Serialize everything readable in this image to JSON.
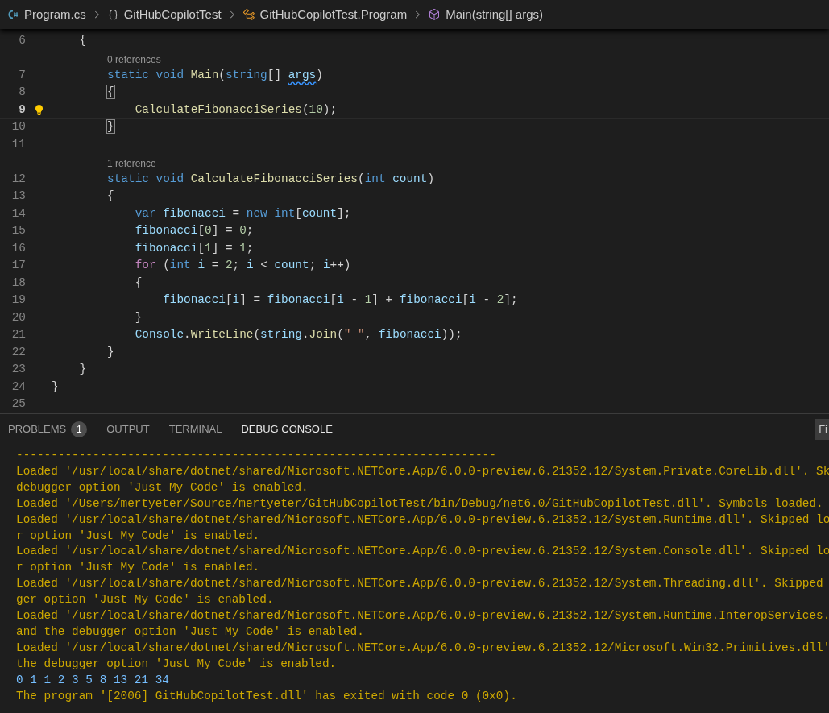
{
  "breadcrumbs": [
    {
      "kind": "file",
      "label": "Program.cs"
    },
    {
      "kind": "namespace",
      "label": "GitHubCopilotTest"
    },
    {
      "kind": "class",
      "label": "GitHubCopilotTest.Program"
    },
    {
      "kind": "method",
      "label": "Main(string[] args)"
    }
  ],
  "editor": {
    "lines": [
      {
        "number": "6",
        "current": false,
        "tokens": [
          {
            "kind": "plain",
            "text": "    {"
          }
        ]
      },
      {
        "number": "7",
        "current": false,
        "codelens": "0 references",
        "tokens": [
          {
            "kind": "kw",
            "text": "        static void "
          },
          {
            "kind": "fn",
            "text": "Main"
          },
          {
            "kind": "plain",
            "text": "("
          },
          {
            "kind": "kw",
            "text": "string"
          },
          {
            "kind": "plain",
            "text": "[] "
          },
          {
            "kind": "warn",
            "text": "args"
          },
          {
            "kind": "plain",
            "text": ")"
          }
        ]
      },
      {
        "number": "8",
        "current": false,
        "tokens": [
          {
            "kind": "bracket",
            "text": "        {"
          }
        ]
      },
      {
        "number": "9",
        "current": true,
        "tokens": [
          {
            "kind": "fn",
            "text": "            CalculateFibonacciSeries"
          },
          {
            "kind": "plain",
            "text": "("
          },
          {
            "kind": "num",
            "text": "10"
          },
          {
            "kind": "plain",
            "text": ");"
          }
        ]
      },
      {
        "number": "10",
        "current": false,
        "tokens": [
          {
            "kind": "bracket",
            "text": "        }"
          }
        ]
      },
      {
        "number": "11",
        "current": false
      },
      {
        "number": "12",
        "current": false,
        "codelens": "1 reference",
        "tokens": [
          {
            "kind": "kw",
            "text": "        static void "
          },
          {
            "kind": "fn",
            "text": "CalculateFibonacciSeries"
          },
          {
            "kind": "plain",
            "text": "("
          },
          {
            "kind": "kw",
            "text": "int "
          },
          {
            "kind": "var",
            "text": "count"
          },
          {
            "kind": "plain",
            "text": ")"
          }
        ]
      },
      {
        "number": "13",
        "current": false,
        "tokens": [
          {
            "kind": "plain",
            "text": "        {"
          }
        ]
      },
      {
        "number": "14",
        "current": false,
        "tokens": [
          {
            "kind": "kw",
            "text": "            var "
          },
          {
            "kind": "var",
            "text": "fibonacci"
          },
          {
            "kind": "plain",
            "text": " = "
          },
          {
            "kind": "kw",
            "text": "new int"
          },
          {
            "kind": "plain",
            "text": "["
          },
          {
            "kind": "var",
            "text": "count"
          },
          {
            "kind": "plain",
            "text": "];"
          }
        ]
      },
      {
        "number": "15",
        "current": false,
        "tokens": [
          {
            "kind": "var",
            "text": "            fibonacci"
          },
          {
            "kind": "plain",
            "text": "["
          },
          {
            "kind": "num",
            "text": "0"
          },
          {
            "kind": "plain",
            "text": "] = "
          },
          {
            "kind": "num",
            "text": "0"
          },
          {
            "kind": "plain",
            "text": ";"
          }
        ]
      },
      {
        "number": "16",
        "current": false,
        "tokens": [
          {
            "kind": "var",
            "text": "            fibonacci"
          },
          {
            "kind": "plain",
            "text": "["
          },
          {
            "kind": "num",
            "text": "1"
          },
          {
            "kind": "plain",
            "text": "] = "
          },
          {
            "kind": "num",
            "text": "1"
          },
          {
            "kind": "plain",
            "text": ";"
          }
        ]
      },
      {
        "number": "17",
        "current": false,
        "tokens": [
          {
            "kind": "ctrl",
            "text": "            for"
          },
          {
            "kind": "plain",
            "text": " ("
          },
          {
            "kind": "kw",
            "text": "int "
          },
          {
            "kind": "var",
            "text": "i"
          },
          {
            "kind": "plain",
            "text": " = "
          },
          {
            "kind": "num",
            "text": "2"
          },
          {
            "kind": "plain",
            "text": "; "
          },
          {
            "kind": "var",
            "text": "i"
          },
          {
            "kind": "plain",
            "text": " < "
          },
          {
            "kind": "var",
            "text": "count"
          },
          {
            "kind": "plain",
            "text": "; "
          },
          {
            "kind": "var",
            "text": "i"
          },
          {
            "kind": "plain",
            "text": "++)"
          }
        ]
      },
      {
        "number": "18",
        "current": false,
        "tokens": [
          {
            "kind": "plain",
            "text": "            {"
          }
        ]
      },
      {
        "number": "19",
        "current": false,
        "tokens": [
          {
            "kind": "var",
            "text": "                fibonacci"
          },
          {
            "kind": "plain",
            "text": "["
          },
          {
            "kind": "var",
            "text": "i"
          },
          {
            "kind": "plain",
            "text": "] = "
          },
          {
            "kind": "var",
            "text": "fibonacci"
          },
          {
            "kind": "plain",
            "text": "["
          },
          {
            "kind": "var",
            "text": "i"
          },
          {
            "kind": "plain",
            "text": " - "
          },
          {
            "kind": "num",
            "text": "1"
          },
          {
            "kind": "plain",
            "text": "] + "
          },
          {
            "kind": "var",
            "text": "fibonacci"
          },
          {
            "kind": "plain",
            "text": "["
          },
          {
            "kind": "var",
            "text": "i"
          },
          {
            "kind": "plain",
            "text": " - "
          },
          {
            "kind": "num",
            "text": "2"
          },
          {
            "kind": "plain",
            "text": "];"
          }
        ]
      },
      {
        "number": "20",
        "current": false,
        "tokens": [
          {
            "kind": "plain",
            "text": "            }"
          }
        ]
      },
      {
        "number": "21",
        "current": false,
        "tokens": [
          {
            "kind": "var",
            "text": "            Console"
          },
          {
            "kind": "plain",
            "text": "."
          },
          {
            "kind": "fn",
            "text": "WriteLine"
          },
          {
            "kind": "plain",
            "text": "("
          },
          {
            "kind": "var",
            "text": "string"
          },
          {
            "kind": "plain",
            "text": "."
          },
          {
            "kind": "fn",
            "text": "Join"
          },
          {
            "kind": "plain",
            "text": "("
          },
          {
            "kind": "str",
            "text": "\" \""
          },
          {
            "kind": "plain",
            "text": ", "
          },
          {
            "kind": "var",
            "text": "fibonacci"
          },
          {
            "kind": "plain",
            "text": "));"
          }
        ]
      },
      {
        "number": "22",
        "current": false,
        "tokens": [
          {
            "kind": "plain",
            "text": "        }"
          }
        ]
      },
      {
        "number": "23",
        "current": false,
        "tokens": [
          {
            "kind": "plain",
            "text": "    }"
          }
        ]
      },
      {
        "number": "24",
        "current": false,
        "tokens": [
          {
            "kind": "plain",
            "text": "}"
          }
        ]
      },
      {
        "number": "25",
        "current": false
      }
    ]
  },
  "panel": {
    "tabs": [
      {
        "label": "PROBLEMS",
        "badge": "1",
        "selected": false
      },
      {
        "label": "OUTPUT",
        "selected": false
      },
      {
        "label": "TERMINAL",
        "selected": false
      },
      {
        "label": "DEBUG CONSOLE",
        "selected": true
      }
    ],
    "filter_field": {
      "value": "Fi"
    },
    "console": [
      {
        "kind": "log",
        "text": "---------------------------------------------------------------------"
      },
      {
        "kind": "log",
        "text": "Loaded '/usr/local/share/dotnet/shared/Microsoft.NETCore.App/6.0.0-preview.6.21352.12/System.Private.CoreLib.dll'. Sk"
      },
      {
        "kind": "log",
        "text": "debugger option 'Just My Code' is enabled."
      },
      {
        "kind": "log",
        "text": "Loaded '/Users/mertyeter/Source/mertyeter/GitHubCopilotTest/bin/Debug/net6.0/GitHubCopilotTest.dll'. Symbols loaded."
      },
      {
        "kind": "log",
        "text": "Loaded '/usr/local/share/dotnet/shared/Microsoft.NETCore.App/6.0.0-preview.6.21352.12/System.Runtime.dll'. Skipped lo"
      },
      {
        "kind": "log",
        "text": "r option 'Just My Code' is enabled."
      },
      {
        "kind": "log",
        "text": "Loaded '/usr/local/share/dotnet/shared/Microsoft.NETCore.App/6.0.0-preview.6.21352.12/System.Console.dll'. Skipped lo"
      },
      {
        "kind": "log",
        "text": "r option 'Just My Code' is enabled."
      },
      {
        "kind": "log",
        "text": "Loaded '/usr/local/share/dotnet/shared/Microsoft.NETCore.App/6.0.0-preview.6.21352.12/System.Threading.dll'. Skipped"
      },
      {
        "kind": "log",
        "text": "ger option 'Just My Code' is enabled."
      },
      {
        "kind": "log",
        "text": "Loaded '/usr/local/share/dotnet/shared/Microsoft.NETCore.App/6.0.0-preview.6.21352.12/System.Runtime.InteropServices."
      },
      {
        "kind": "log",
        "text": "and the debugger option 'Just My Code' is enabled."
      },
      {
        "kind": "log",
        "text": "Loaded '/usr/local/share/dotnet/shared/Microsoft.NETCore.App/6.0.0-preview.6.21352.12/Microsoft.Win32.Primitives.dll'"
      },
      {
        "kind": "log",
        "text": "the debugger option 'Just My Code' is enabled."
      },
      {
        "kind": "output",
        "text": "0 1 1 2 3 5 8 13 21 34"
      },
      {
        "kind": "log",
        "text": "The program '[2006] GitHubCopilotTest.dll' has exited with code 0 (0x0)."
      }
    ]
  }
}
